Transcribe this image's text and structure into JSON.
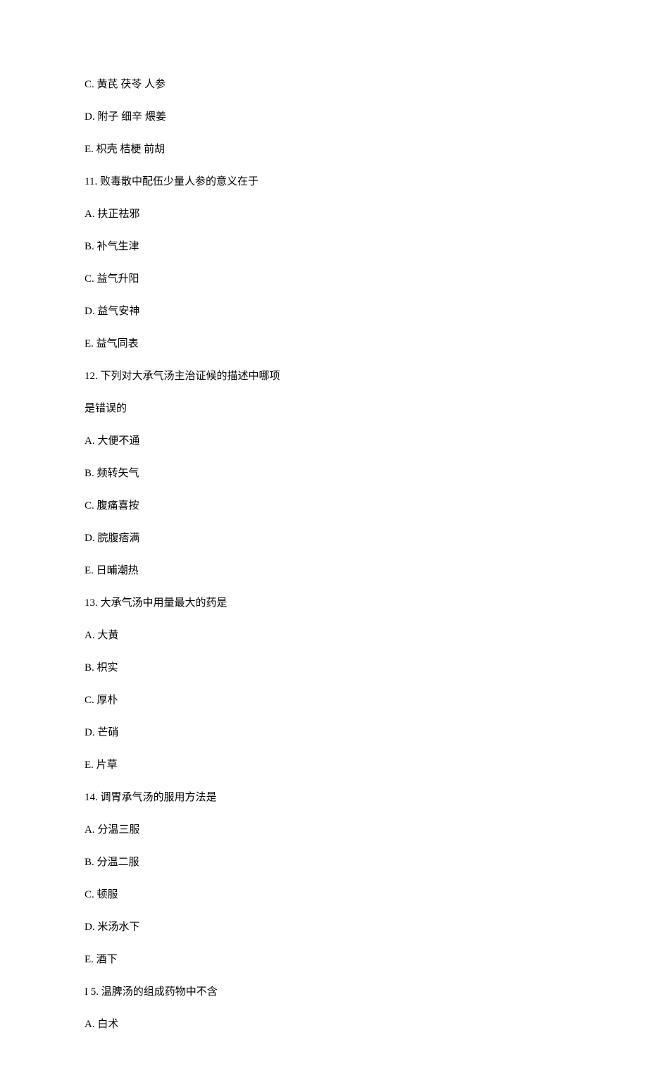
{
  "lines": [
    "C.  黄芪  茯苓  人参",
    "D.  附子  细辛  煨姜",
    "E.  枳壳  桔梗  前胡",
    "11.  败毒散中配伍少量人参的意义在于",
    "A.  扶正祛邪",
    "B.  补气生津",
    "C.  益气升阳",
    "D.  益气安神",
    "E.  益气同表",
    "12.  下列对大承气汤主治证候的描述中哪项",
    "是错误的",
    "A.  大便不通",
    "B.  频转矢气",
    "C.  腹痛喜按",
    "D.  脘腹痞满",
    "E.  日晡潮热",
    "13.  大承气汤中用量最大的药是",
    "A.  大黄",
    "B.  枳实",
    "C.  厚朴",
    "D.  芒硝",
    "E.  片草",
    "14.  调胃承气汤的服用方法是",
    "A.  分温三服",
    "B.  分温二服",
    "C.  顿服",
    "D.  米汤水下",
    "E.  酒下",
    "I 5. 温脾汤的组成药物中不含",
    "A.     白术"
  ]
}
